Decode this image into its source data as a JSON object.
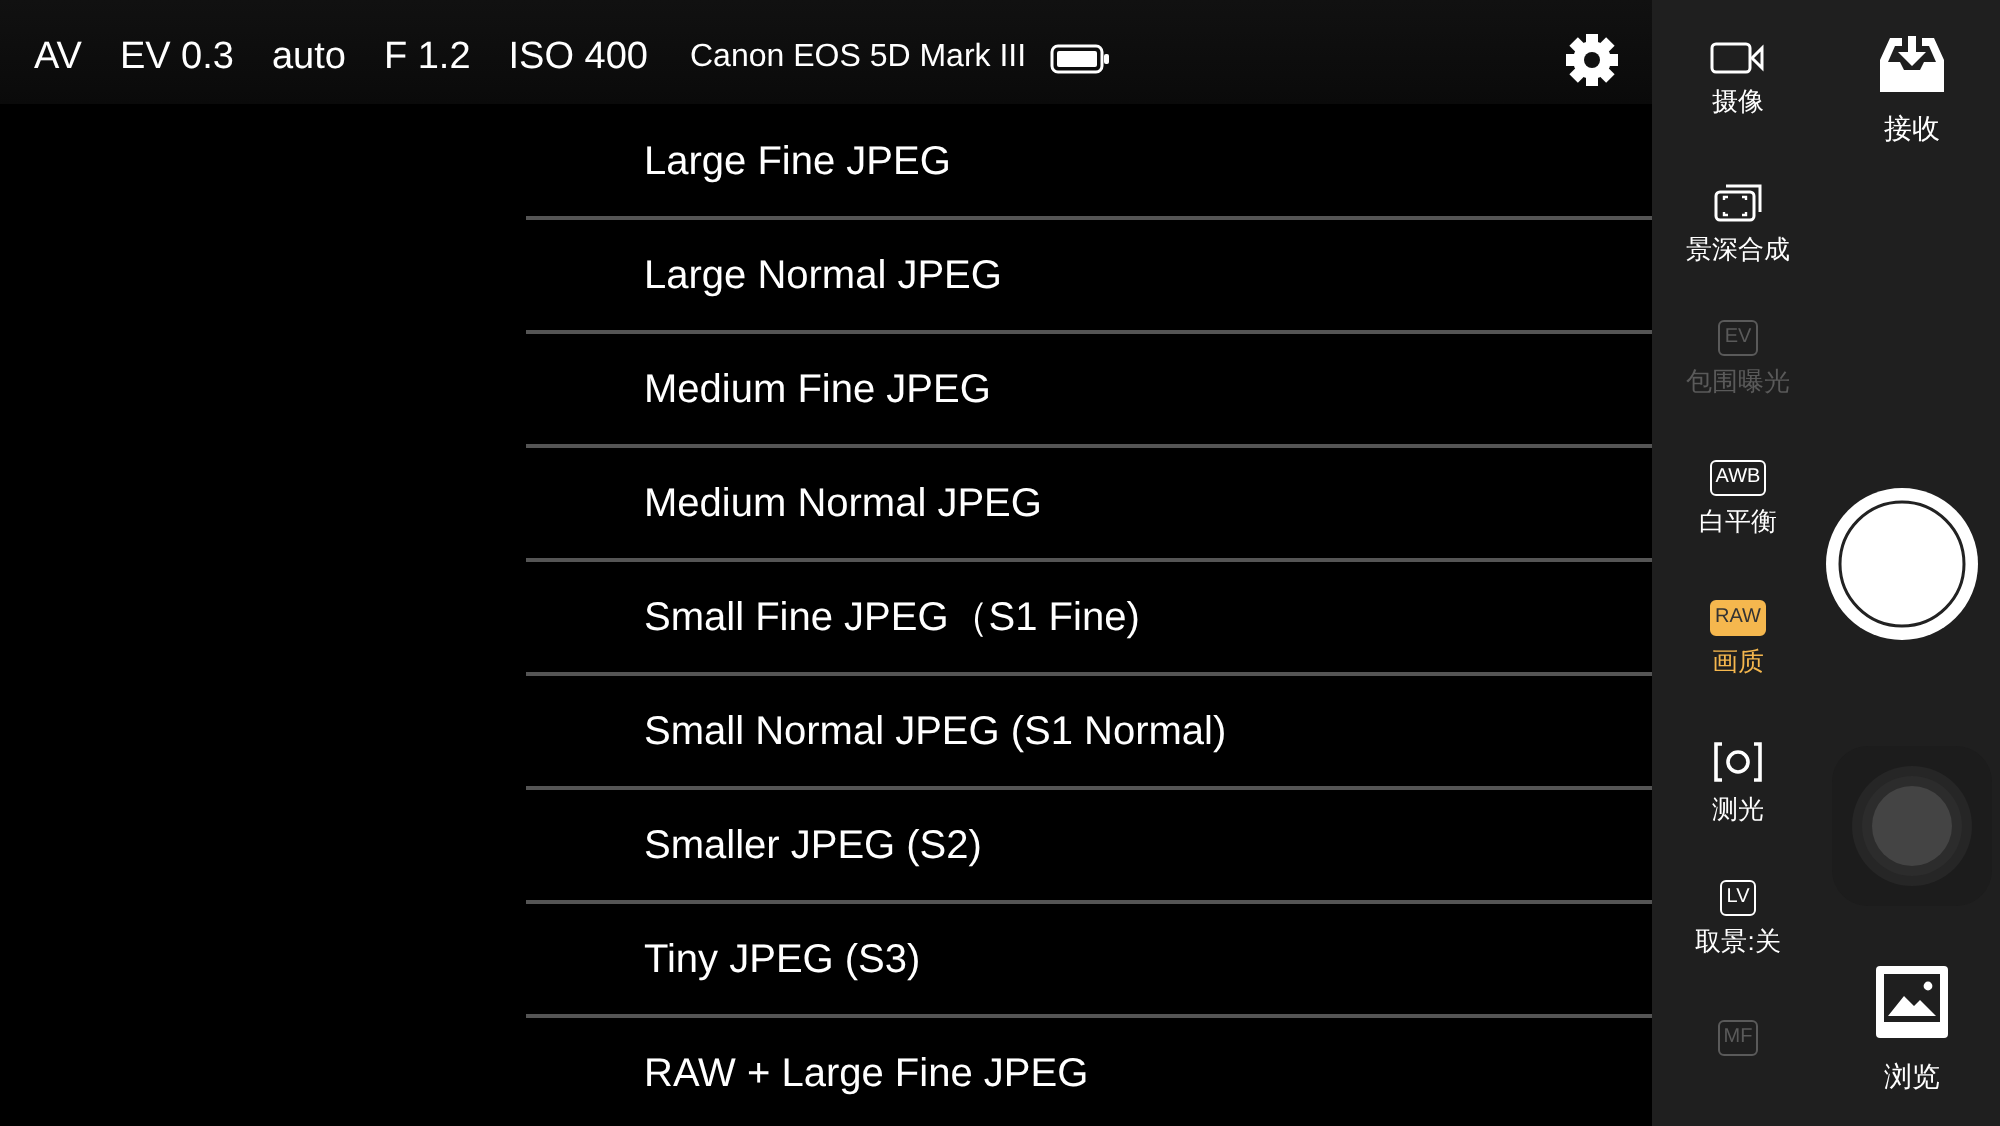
{
  "status_bar": {
    "items": [
      "AV",
      "EV 0.3",
      "auto",
      "F 1.2",
      "ISO 400"
    ],
    "camera": "Canon EOS 5D Mark III"
  },
  "quality_options": [
    {
      "label": "Large Fine JPEG"
    },
    {
      "label": "Large Normal JPEG"
    },
    {
      "label": "Medium Fine JPEG"
    },
    {
      "label": "Medium Normal JPEG"
    },
    {
      "label": "Small Fine JPEG（S1 Fine)"
    },
    {
      "label": "Small Normal JPEG (S1 Normal)"
    },
    {
      "label": "Smaller JPEG (S2)"
    },
    {
      "label": "Tiny JPEG (S3)"
    },
    {
      "label": "RAW + Large Fine JPEG"
    }
  ],
  "tools": [
    {
      "kind": "video",
      "label": "摄像",
      "selected": false,
      "disabled": false
    },
    {
      "kind": "stack",
      "label": "景深合成",
      "selected": false,
      "disabled": false
    },
    {
      "kind": "stack-text",
      "badge": "EV",
      "label": "包围曝光",
      "selected": false,
      "disabled": true
    },
    {
      "kind": "text-box",
      "badge": "AWB",
      "label": "白平衡",
      "selected": false,
      "disabled": false
    },
    {
      "kind": "text-box",
      "badge": "RAW",
      "label": "画质",
      "selected": true,
      "disabled": false
    },
    {
      "kind": "metering",
      "label": "测光",
      "selected": false,
      "disabled": false
    },
    {
      "kind": "text-box",
      "badge": "LV",
      "label": "取景:关",
      "selected": false,
      "disabled": false
    },
    {
      "kind": "text-box",
      "badge": "MF",
      "selected": false,
      "disabled": true
    }
  ],
  "receive": {
    "label": "接收"
  },
  "browse": {
    "label": "浏览"
  }
}
